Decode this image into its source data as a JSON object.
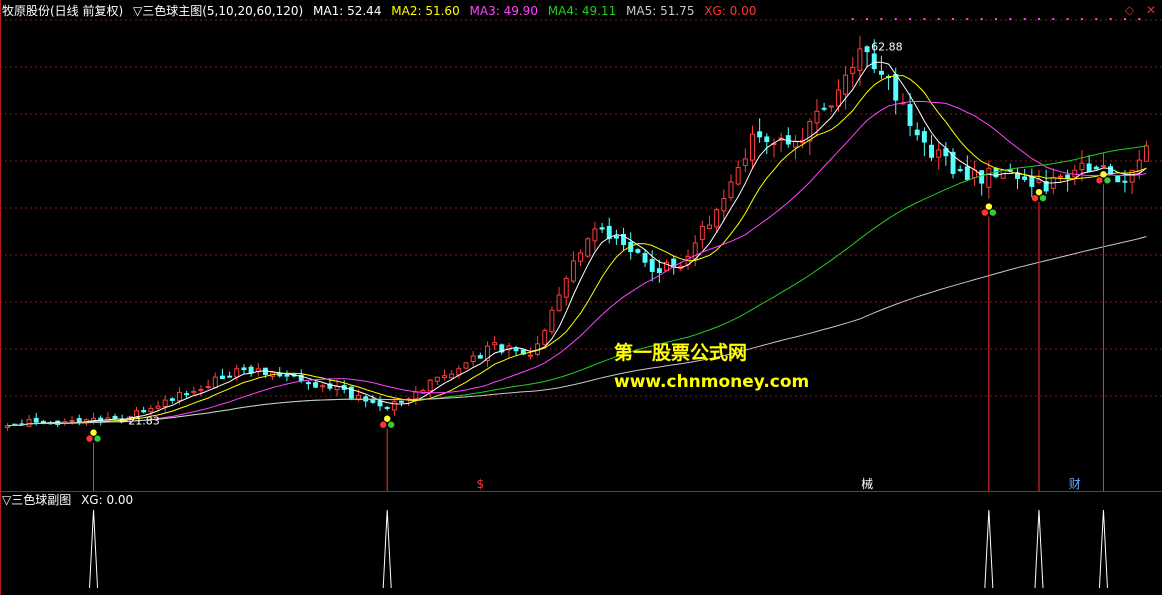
{
  "header": {
    "stock": "牧原股份(日线 前复权)",
    "indicator": "▽三色球主图(5,10,20,60,120)",
    "ma": [
      {
        "label": "MA1: 52.44",
        "color": "#ffffff"
      },
      {
        "label": "MA2: 51.60",
        "color": "#ffff00"
      },
      {
        "label": "MA3: 49.90",
        "color": "#ff44ff"
      },
      {
        "label": "MA4: 49.11",
        "color": "#22cc22"
      },
      {
        "label": "MA5: 51.75",
        "color": "#c8c8c8"
      },
      {
        "label": "XG: 0.00",
        "color": "#ff3333"
      }
    ]
  },
  "sub_header": {
    "title": "▽三色球副图",
    "xg": "XG: 0.00"
  },
  "window_buttons": [
    "◇",
    "✕"
  ],
  "watermark": {
    "line1": "第一股票公式网",
    "line2": "www.chnmoney.com"
  },
  "chart_data": {
    "type": "candlestick",
    "bars": 160,
    "ylim": [
      14,
      66
    ],
    "grid": true,
    "annotations": [
      {
        "text": "←21.83",
        "bar": 15,
        "price": 21.83
      },
      {
        "text": "62.88",
        "bar": 120,
        "price": 62.88
      }
    ],
    "key_points": [
      {
        "bar": 0,
        "price": 21.6
      },
      {
        "bar": 15,
        "price": 21.83
      },
      {
        "bar": 33,
        "price": 27.4
      },
      {
        "bar": 45,
        "price": 25.6
      },
      {
        "bar": 53,
        "price": 23.1
      },
      {
        "bar": 68,
        "price": 30.0
      },
      {
        "bar": 73,
        "price": 29.0
      },
      {
        "bar": 82,
        "price": 43.6
      },
      {
        "bar": 90,
        "price": 38.3
      },
      {
        "bar": 95,
        "price": 39.6
      },
      {
        "bar": 104,
        "price": 52.6
      },
      {
        "bar": 110,
        "price": 51.8
      },
      {
        "bar": 120,
        "price": 62.88
      },
      {
        "bar": 128,
        "price": 51.8
      },
      {
        "bar": 134,
        "price": 48.4
      },
      {
        "bar": 140,
        "price": 49.2
      },
      {
        "bar": 145,
        "price": 47.5
      },
      {
        "bar": 150,
        "price": 50.3
      },
      {
        "bar": 156,
        "price": 48.6
      },
      {
        "bar": 159,
        "price": 52.6
      }
    ],
    "signals": [
      12,
      53,
      137,
      144,
      153
    ],
    "markers": [
      {
        "text": "$",
        "bar": 66,
        "color": "#ff3333"
      },
      {
        "text": "械",
        "bar": 120,
        "color": "#ffffff"
      },
      {
        "text": "财",
        "bar": 149,
        "color": "#66aaff"
      }
    ]
  }
}
